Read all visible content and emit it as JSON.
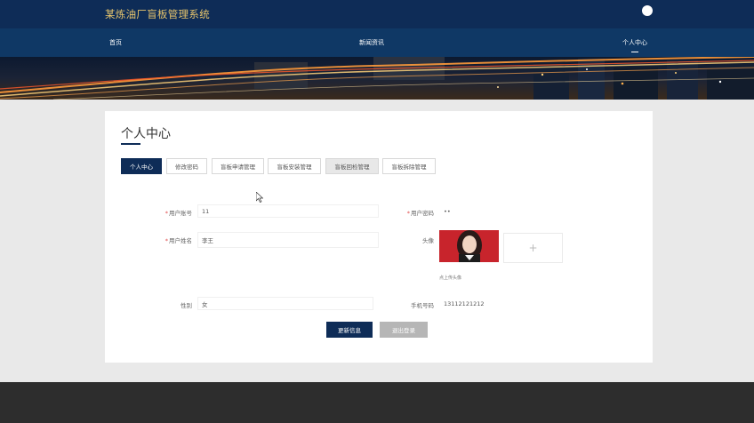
{
  "header": {
    "site_title": "某炼油厂盲板管理系统"
  },
  "nav": {
    "items": [
      {
        "label": "首页",
        "active": false
      },
      {
        "label": "新闻资讯",
        "active": false
      },
      {
        "label": "个人中心",
        "active": true
      }
    ]
  },
  "page": {
    "heading": "个人中心"
  },
  "tabs": [
    {
      "label": "个人中心",
      "active": true
    },
    {
      "label": "修改密码",
      "active": false
    },
    {
      "label": "盲板申请管理",
      "active": false
    },
    {
      "label": "盲板安装管理",
      "active": false
    },
    {
      "label": "盲板回检管理",
      "active": false
    },
    {
      "label": "盲板拆除管理",
      "active": false
    }
  ],
  "form": {
    "account_label": "用户账号",
    "account_value": "11",
    "password_label": "用户密码",
    "password_value": "••",
    "name_label": "用户姓名",
    "name_value": "李王",
    "avatar_label": "头像",
    "avatar_hint": "点上传头像",
    "upload_plus": "+",
    "gender_label": "性别",
    "gender_value": "女",
    "phone_label": "手机号码",
    "phone_value": "13112121212",
    "required_mark": "*"
  },
  "buttons": {
    "update": "更新信息",
    "logout": "退出登录"
  },
  "colors": {
    "header_bg": "#0e2c57",
    "nav_bg": "#0f3865",
    "title_gold": "#e7c56c",
    "primary_button": "#0e2c57",
    "secondary_button": "#b6b6b6",
    "footer_bg": "#2d2d2d"
  }
}
